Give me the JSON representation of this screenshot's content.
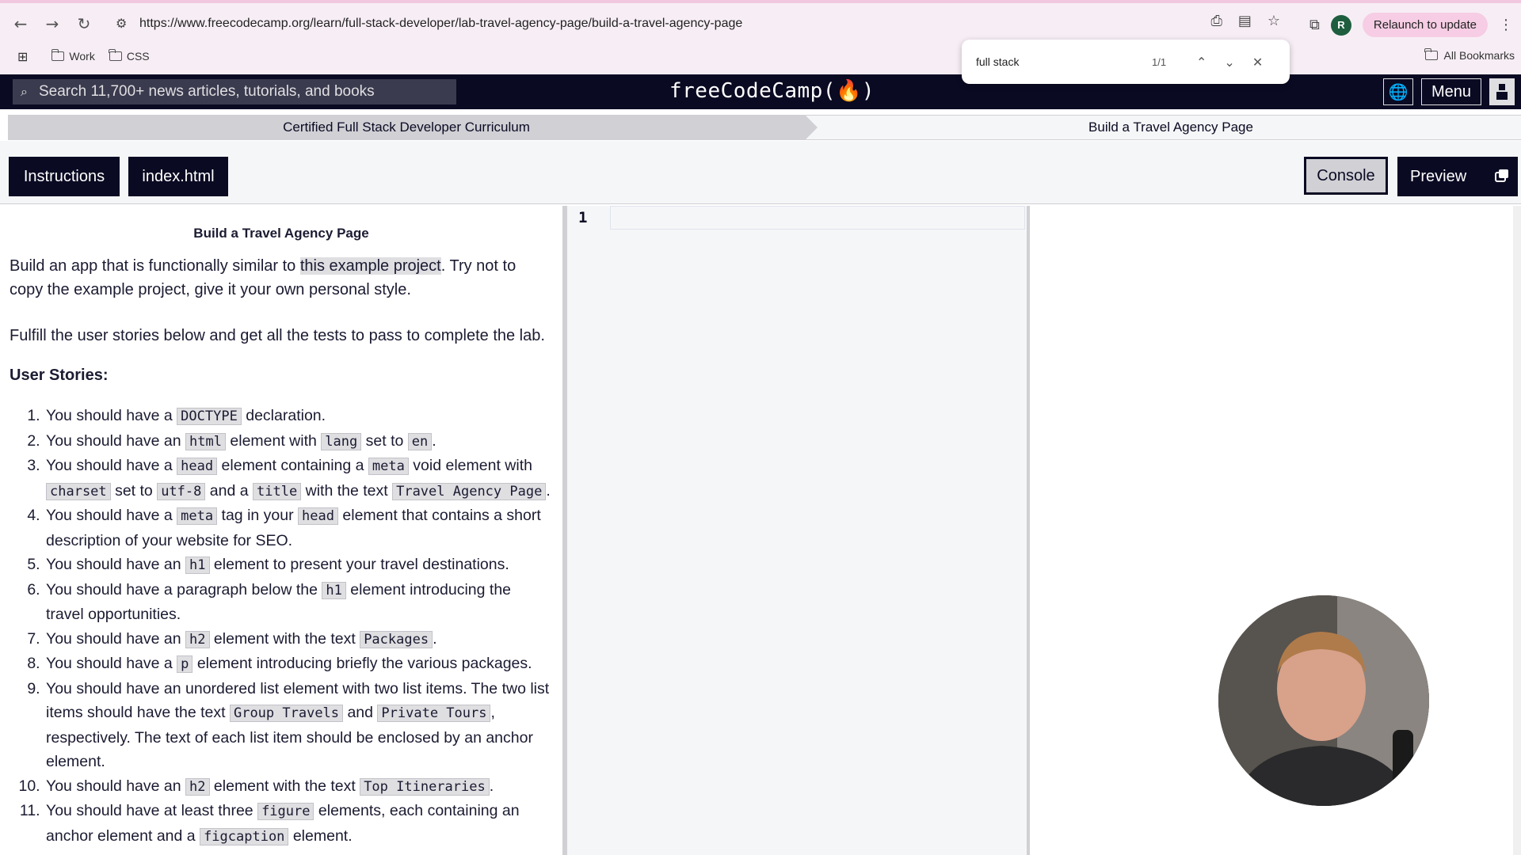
{
  "browser": {
    "url": "https://www.freecodecamp.org/learn/full-stack-developer/lab-travel-agency-page/build-a-travel-agency-page",
    "relaunch_label": "Relaunch to update",
    "profile_initial": "R",
    "bookmarks": [
      "Work",
      "CSS"
    ],
    "all_bookmarks_label": "All Bookmarks"
  },
  "find_bar": {
    "query": "full stack",
    "count": "1/1"
  },
  "fcc_nav": {
    "search_placeholder": "Search 11,700+ news articles, tutorials, and books",
    "logo": "freeCodeCamp(🔥)",
    "menu_label": "Menu"
  },
  "breadcrumb": {
    "curriculum": "Certified Full Stack Developer Curriculum",
    "current": "Build a Travel Agency Page"
  },
  "toolbar": {
    "instructions_label": "Instructions",
    "file_label": "index.html",
    "console_label": "Console",
    "preview_label": "Preview"
  },
  "instructions": {
    "title": "Build a Travel Agency Page",
    "intro_before": "Build an app that is functionally similar to ",
    "intro_link": "this example project",
    "intro_after": ". Try not to copy the example project, give it your own personal style.",
    "fulfill": "Fulfill the user stories below and get all the tests to pass to complete the lab.",
    "stories_heading": "User Stories:",
    "stories": [
      [
        {
          "t": "You should have a "
        },
        {
          "c": "DOCTYPE"
        },
        {
          "t": " declaration."
        }
      ],
      [
        {
          "t": "You should have an "
        },
        {
          "c": "html"
        },
        {
          "t": " element with "
        },
        {
          "c": "lang"
        },
        {
          "t": " set to "
        },
        {
          "c": "en"
        },
        {
          "t": "."
        }
      ],
      [
        {
          "t": "You should have a "
        },
        {
          "c": "head"
        },
        {
          "t": " element containing a "
        },
        {
          "c": "meta"
        },
        {
          "t": " void element with "
        },
        {
          "c": "charset"
        },
        {
          "t": " set to "
        },
        {
          "c": "utf-8"
        },
        {
          "t": " and a "
        },
        {
          "c": "title"
        },
        {
          "t": " with the text "
        },
        {
          "c": "Travel Agency Page"
        },
        {
          "t": "."
        }
      ],
      [
        {
          "t": "You should have a "
        },
        {
          "c": "meta"
        },
        {
          "t": " tag in your "
        },
        {
          "c": "head"
        },
        {
          "t": " element that contains a short description of your website for SEO."
        }
      ],
      [
        {
          "t": "You should have an "
        },
        {
          "c": "h1"
        },
        {
          "t": " element to present your travel destinations."
        }
      ],
      [
        {
          "t": "You should have a paragraph below the "
        },
        {
          "c": "h1"
        },
        {
          "t": " element introducing the travel opportunities."
        }
      ],
      [
        {
          "t": "You should have an "
        },
        {
          "c": "h2"
        },
        {
          "t": " element with the text "
        },
        {
          "c": "Packages"
        },
        {
          "t": "."
        }
      ],
      [
        {
          "t": "You should have a "
        },
        {
          "c": "p"
        },
        {
          "t": " element introducing briefly the various packages."
        }
      ],
      [
        {
          "t": "You should have an unordered list element with two list items. The two list items should have the text "
        },
        {
          "c": "Group Travels"
        },
        {
          "t": " and "
        },
        {
          "c": "Private Tours"
        },
        {
          "t": ", respectively. The text of each list item should be enclosed by an anchor element."
        }
      ],
      [
        {
          "t": "You should have an "
        },
        {
          "c": "h2"
        },
        {
          "t": " element with the text "
        },
        {
          "c": "Top Itineraries"
        },
        {
          "t": "."
        }
      ],
      [
        {
          "t": "You should have at least three "
        },
        {
          "c": "figure"
        },
        {
          "t": " elements, each containing an anchor element and a "
        },
        {
          "c": "figcaption"
        },
        {
          "t": " element."
        }
      ]
    ]
  },
  "editor": {
    "line_numbers": [
      "1"
    ]
  }
}
